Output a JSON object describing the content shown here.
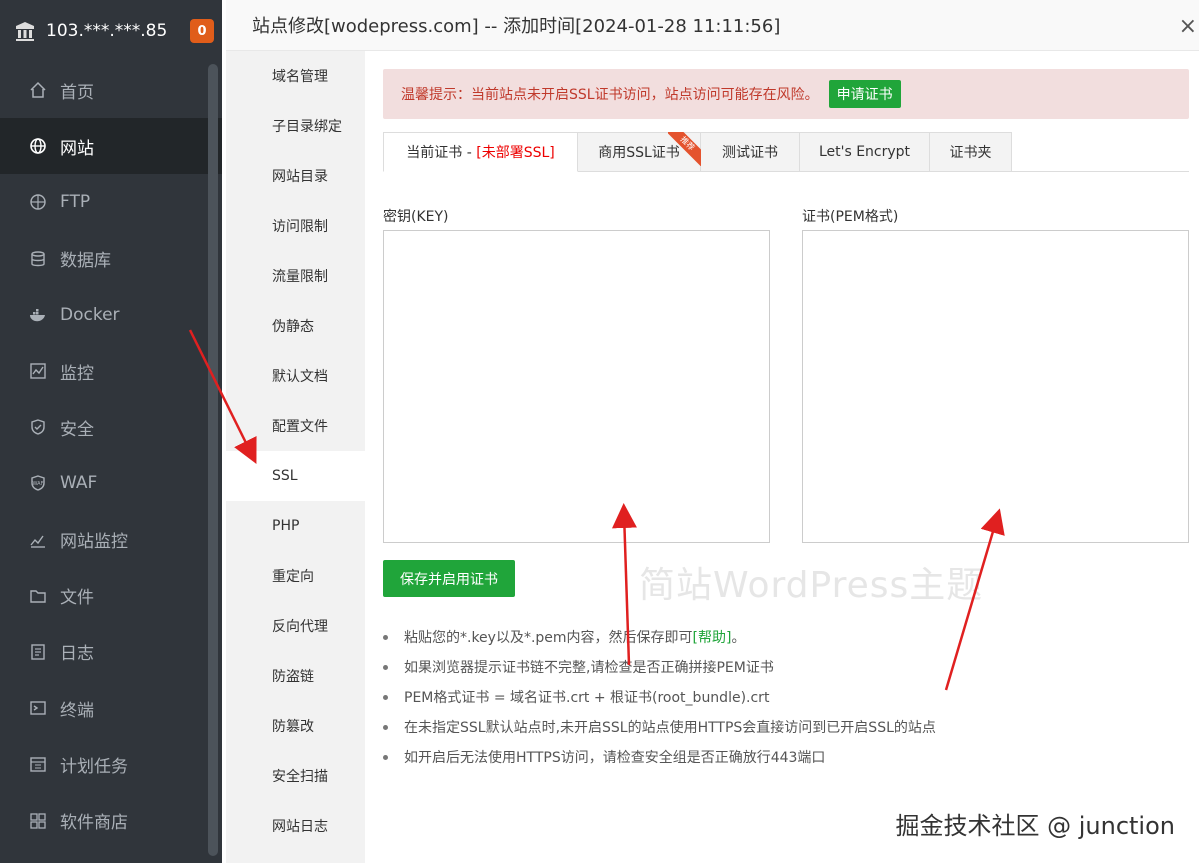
{
  "sidebar": {
    "ip": "103.***.***.85",
    "badge": "0",
    "items": [
      {
        "label": "首页",
        "icon": "home-icon"
      },
      {
        "label": "网站",
        "icon": "globe-icon"
      },
      {
        "label": "FTP",
        "icon": "ftp-icon"
      },
      {
        "label": "数据库",
        "icon": "database-icon"
      },
      {
        "label": "Docker",
        "icon": "docker-icon"
      },
      {
        "label": "监控",
        "icon": "monitor-icon"
      },
      {
        "label": "安全",
        "icon": "shield-icon"
      },
      {
        "label": "WAF",
        "icon": "waf-icon"
      },
      {
        "label": "网站监控",
        "icon": "chart-icon"
      },
      {
        "label": "文件",
        "icon": "folder-icon"
      },
      {
        "label": "日志",
        "icon": "log-icon"
      },
      {
        "label": "终端",
        "icon": "terminal-icon"
      },
      {
        "label": "计划任务",
        "icon": "calendar-icon"
      },
      {
        "label": "软件商店",
        "icon": "grid-icon"
      }
    ],
    "active_index": 1
  },
  "dialog": {
    "title": "站点修改[wodepress.com] -- 添加时间[2024-01-28 11:11:56]",
    "close": "×",
    "nav": [
      "域名管理",
      "子目录绑定",
      "网站目录",
      "访问限制",
      "流量限制",
      "伪静态",
      "默认文档",
      "配置文件",
      "SSL",
      "PHP",
      "重定向",
      "反向代理",
      "防盗链",
      "防篡改",
      "安全扫描",
      "网站日志"
    ],
    "nav_active_index": 8
  },
  "alert": {
    "text": "温馨提示：当前站点未开启SSL证书访问，站点访问可能存在风险。",
    "button": "申请证书"
  },
  "ssl_tabs": {
    "current_prefix": "当前证书 - ",
    "current_status": "[未部署SSL]",
    "commercial": "商用SSL证书",
    "commercial_ribbon": "推荐",
    "test": "测试证书",
    "letsencrypt": "Let's Encrypt",
    "folder": "证书夹"
  },
  "fields": {
    "key_label": "密钥(KEY)",
    "key_value": "",
    "cert_label": "证书(PEM格式)",
    "cert_value": ""
  },
  "save_button": "保存并启用证书",
  "watermark": "简站WordPress主题",
  "tips": {
    "tip1_text": "粘贴您的*.key以及*.pem内容，然后保存即可",
    "tip1_help": "[帮助]",
    "tip1_end": "。",
    "tip2": "如果浏览器提示证书链不完整,请检查是否正确拼接PEM证书",
    "tip3": "PEM格式证书 = 域名证书.crt + 根证书(root_bundle).crt",
    "tip4": "在未指定SSL默认站点时,未开启SSL的站点使用HTTPS会直接访问到已开启SSL的站点",
    "tip5": "如开启后无法使用HTTPS访问，请检查安全组是否正确放行443端口"
  },
  "footer_watermark": "掘金技术社区 @ junction",
  "colors": {
    "sidebar_bg": "#30353b",
    "accent_green": "#20a53a",
    "alert_bg": "#f2dede",
    "alert_text": "#c0392b",
    "badge": "#e05d1a",
    "arrow": "#e02020"
  }
}
